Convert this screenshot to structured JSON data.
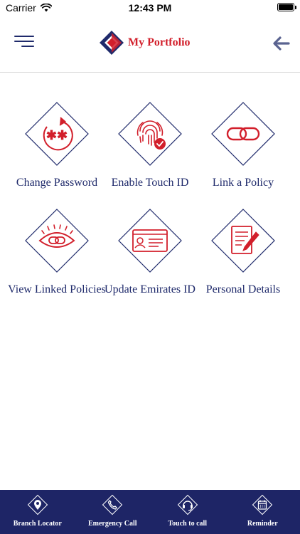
{
  "status_bar": {
    "carrier": "Carrier",
    "time": "12:43 PM"
  },
  "header": {
    "title": "My Portfolio",
    "menu_icon": "hamburger-menu-icon",
    "back_icon": "arrow-left-icon"
  },
  "tiles": [
    {
      "label": "Change Password",
      "icon": "password-reset-icon"
    },
    {
      "label": "Enable Touch ID",
      "icon": "fingerprint-icon"
    },
    {
      "label": "Link a Policy",
      "icon": "link-chain-icon"
    },
    {
      "label": "View Linked Policies",
      "icon": "eye-icon"
    },
    {
      "label": "Update Emirates ID",
      "icon": "id-card-icon"
    },
    {
      "label": "Personal Details",
      "icon": "document-edit-icon"
    }
  ],
  "bottom_nav": [
    {
      "label": "Branch Locator",
      "icon": "location-pin-icon"
    },
    {
      "label": "Emergency Call",
      "icon": "phone-icon"
    },
    {
      "label": "Touch to call",
      "icon": "headset-icon"
    },
    {
      "label": "Reminder",
      "icon": "calendar-icon"
    }
  ],
  "colors": {
    "navy": "#1f2a6b",
    "nav_background": "#1e2566",
    "accent_red": "#d21f2b"
  }
}
